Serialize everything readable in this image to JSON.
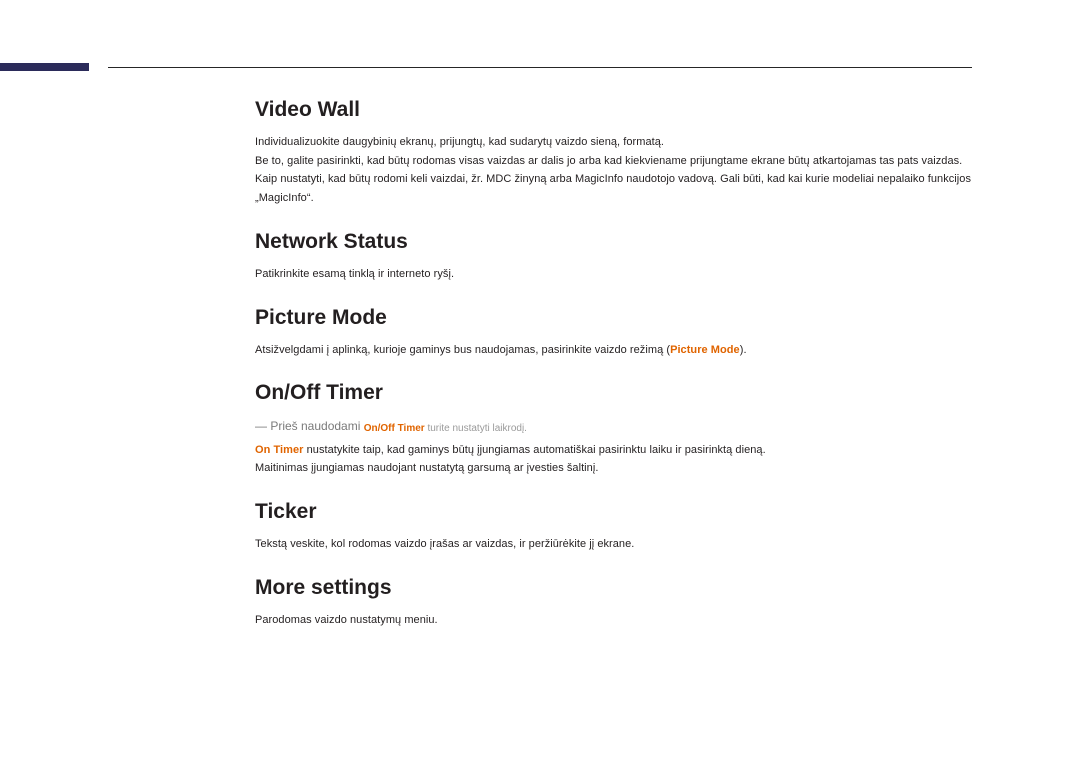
{
  "sections": {
    "videoWall": {
      "heading": "Video Wall",
      "p1": "Individualizuokite daugybinių ekranų, prijungtų, kad sudarytų vaizdo sieną, formatą.",
      "p2": "Be to, galite pasirinkti, kad būtų rodomas visas vaizdas ar dalis jo arba kad kiekviename prijungtame ekrane būtų atkartojamas tas pats vaizdas.",
      "p3": "Kaip nustatyti, kad būtų rodomi keli vaizdai, žr. MDC žinyną arba MagicInfo naudotojo vadovą. Gali būti, kad kai kurie modeliai nepalaiko funkcijos „MagicInfo“."
    },
    "networkStatus": {
      "heading": "Network Status",
      "p1": "Patikrinkite esamą tinklą ir interneto ryšį."
    },
    "pictureMode": {
      "heading": "Picture Mode",
      "p1_prefix": "Atsižvelgdami į aplinką, kurioje gaminys bus naudojamas, pasirinkite vaizdo režimą (",
      "p1_highlight": "Picture Mode",
      "p1_suffix": ")."
    },
    "onOffTimer": {
      "heading": "On/Off Timer",
      "note_prefix": "―  Prieš naudodami ",
      "note_highlight": "On/Off Timer",
      "note_suffix": " turite nustatyti laikrodį.",
      "p2_highlight": "On Timer",
      "p2_suffix": " nustatykite taip, kad gaminys būtų įjungiamas automatiškai pasirinktu laiku ir pasirinktą dieną.",
      "p3": "Maitinimas įjungiamas naudojant nustatytą garsumą ar įvesties šaltinį."
    },
    "ticker": {
      "heading": "Ticker",
      "p1": "Tekstą veskite, kol rodomas vaizdo įrašas ar vaizdas, ir peržiūrėkite jį ekrane."
    },
    "moreSettings": {
      "heading": "More settings",
      "p1": "Parodomas vaizdo nustatymų meniu."
    }
  }
}
